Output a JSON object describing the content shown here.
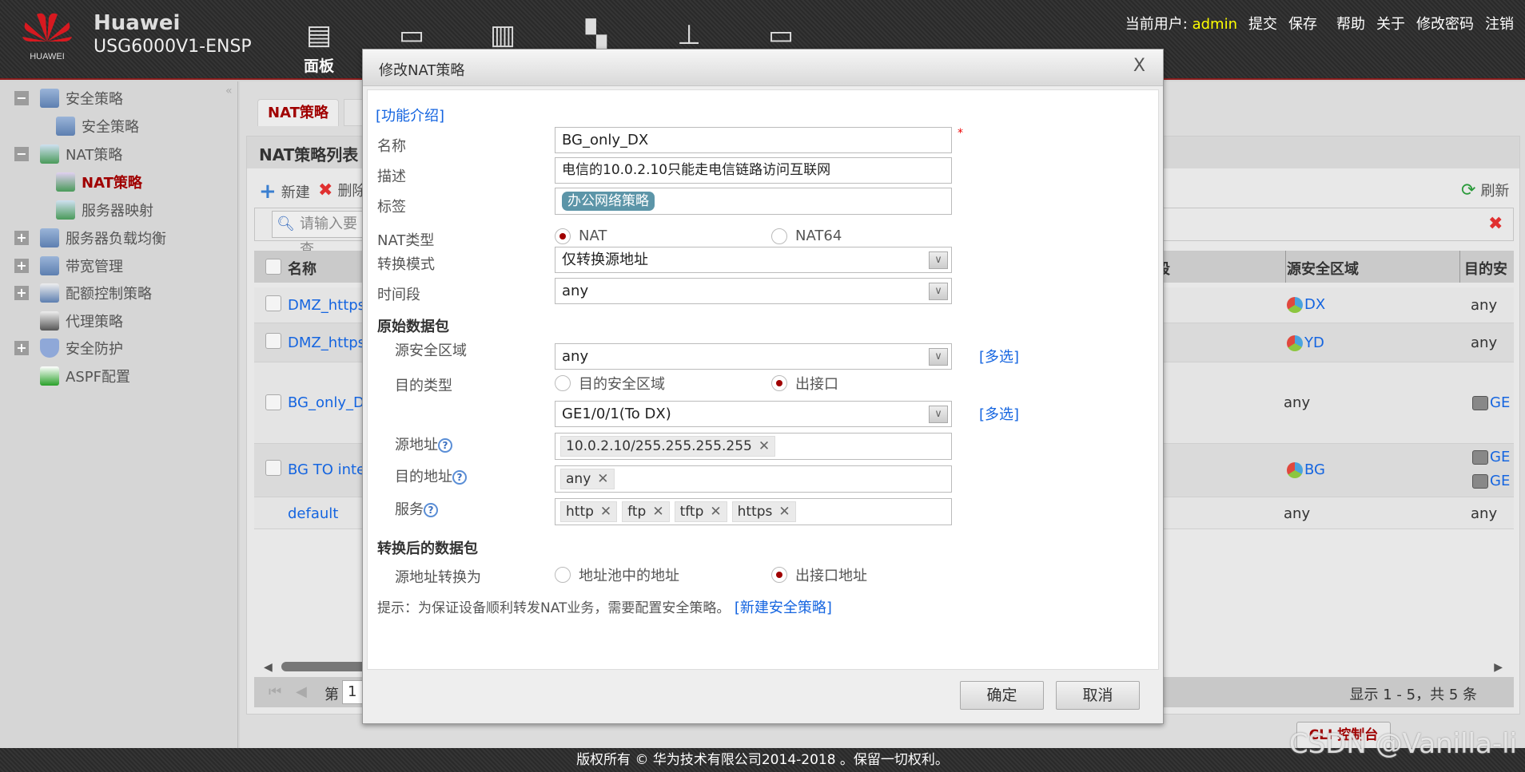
{
  "header": {
    "brand_name": "Huawei",
    "device_model": "USG6000V1-ENSP",
    "logo_text": "HUAWEI",
    "nav": [
      {
        "icon": "dashboard-icon",
        "label": "面板"
      },
      {
        "icon": "monitor-icon"
      },
      {
        "icon": "policy-icon"
      },
      {
        "icon": "object-icon"
      },
      {
        "icon": "network-icon"
      },
      {
        "icon": "system-icon"
      }
    ],
    "current_user_label": "当前用户:",
    "current_user": "admin",
    "links": [
      "提交",
      "保存",
      "帮助",
      "关于",
      "修改密码",
      "注销"
    ]
  },
  "sidebar": {
    "items": [
      {
        "label": "安全策略",
        "expander": "−"
      },
      {
        "label": "安全策略"
      },
      {
        "label": "NAT策略",
        "expander": "−"
      },
      {
        "label": "NAT策略",
        "active": true
      },
      {
        "label": "服务器映射"
      },
      {
        "label": "服务器负载均衡",
        "expander": "+"
      },
      {
        "label": "带宽管理",
        "expander": "+"
      },
      {
        "label": "配额控制策略",
        "expander": "+"
      },
      {
        "label": "代理策略"
      },
      {
        "label": "安全防护",
        "expander": "+"
      },
      {
        "label": "ASPF配置"
      }
    ],
    "collapse": "«"
  },
  "main": {
    "tab": "NAT策略",
    "panel_title": "NAT策略列表",
    "toolbar": {
      "new": "新建",
      "delete": "删除",
      "refresh": "刷新"
    },
    "search_placeholder": "请输入要查",
    "columns": [
      "名称",
      "段",
      "源安全区域",
      "目的安"
    ],
    "rows": [
      {
        "name": "DMZ_httpse",
        "src_zone": "DX",
        "dst_zone": "any"
      },
      {
        "name": "DMZ_httpse",
        "src_zone": "YD",
        "dst_zone": "any"
      },
      {
        "name": "BG_only_D",
        "src_zone": "any",
        "dst_zone": [
          "GE"
        ]
      },
      {
        "name": "BG TO inter",
        "src_zone": "BG",
        "dst_zone": [
          "GE",
          "GE"
        ]
      },
      {
        "name": "default",
        "src_zone": "any",
        "dst_zone": "any"
      }
    ],
    "pager": {
      "page_label": "第",
      "page": "1",
      "summary": "显示 1 - 5，共 5 条"
    },
    "cli_button": "CLI 控制台"
  },
  "dialog": {
    "title": "修改NAT策略",
    "close": "X",
    "intro_link": "[功能介绍]",
    "fields": {
      "name_label": "名称",
      "name_value": "BG_only_DX",
      "required_mark": "*",
      "desc_label": "描述",
      "desc_value": "电信的10.0.2.10只能走电信链路访问互联网",
      "tag_label": "标签",
      "tag_value": "办公网络策略",
      "nat_type_label": "NAT类型",
      "nat_type_options": [
        "NAT",
        "NAT64"
      ],
      "nat_type_selected": "NAT",
      "mode_label": "转换模式",
      "mode_value": "仅转换源地址",
      "time_label": "时间段",
      "time_value": "any"
    },
    "original_section": "原始数据包",
    "original": {
      "src_zone_label": "源安全区域",
      "src_zone_value": "any",
      "multi_select": "[多选]",
      "dst_type_label": "目的类型",
      "dst_type_options": [
        "目的安全区域",
        "出接口"
      ],
      "dst_type_selected": "出接口",
      "egress_value": "GE1/0/1(To DX)",
      "src_addr_label": "源地址",
      "src_addr_values": [
        "10.0.2.10/255.255.255.255"
      ],
      "dst_addr_label": "目的地址",
      "dst_addr_values": [
        "any"
      ],
      "service_label": "服务",
      "service_values": [
        "http",
        "ftp",
        "tftp",
        "https"
      ]
    },
    "translated_section": "转换后的数据包",
    "translated": {
      "src_translate_label": "源地址转换为",
      "options": [
        "地址池中的地址",
        "出接口地址"
      ],
      "selected": "出接口地址"
    },
    "hint": "提示：为保证设备顺利转发NAT业务，需要配置安全策略。",
    "hint_link": "[新建安全策略]",
    "ok": "确定",
    "cancel": "取消"
  },
  "footer": {
    "copyright": "版权所有 © 华为技术有限公司2014-2018 。保留一切权利。"
  },
  "watermark": "CSDN @Vanilla-li",
  "colors": {
    "accent_red": "#a00000",
    "link_blue": "#1565e0",
    "user_yellow": "#ffff00",
    "tag_teal": "#5c95a8"
  }
}
